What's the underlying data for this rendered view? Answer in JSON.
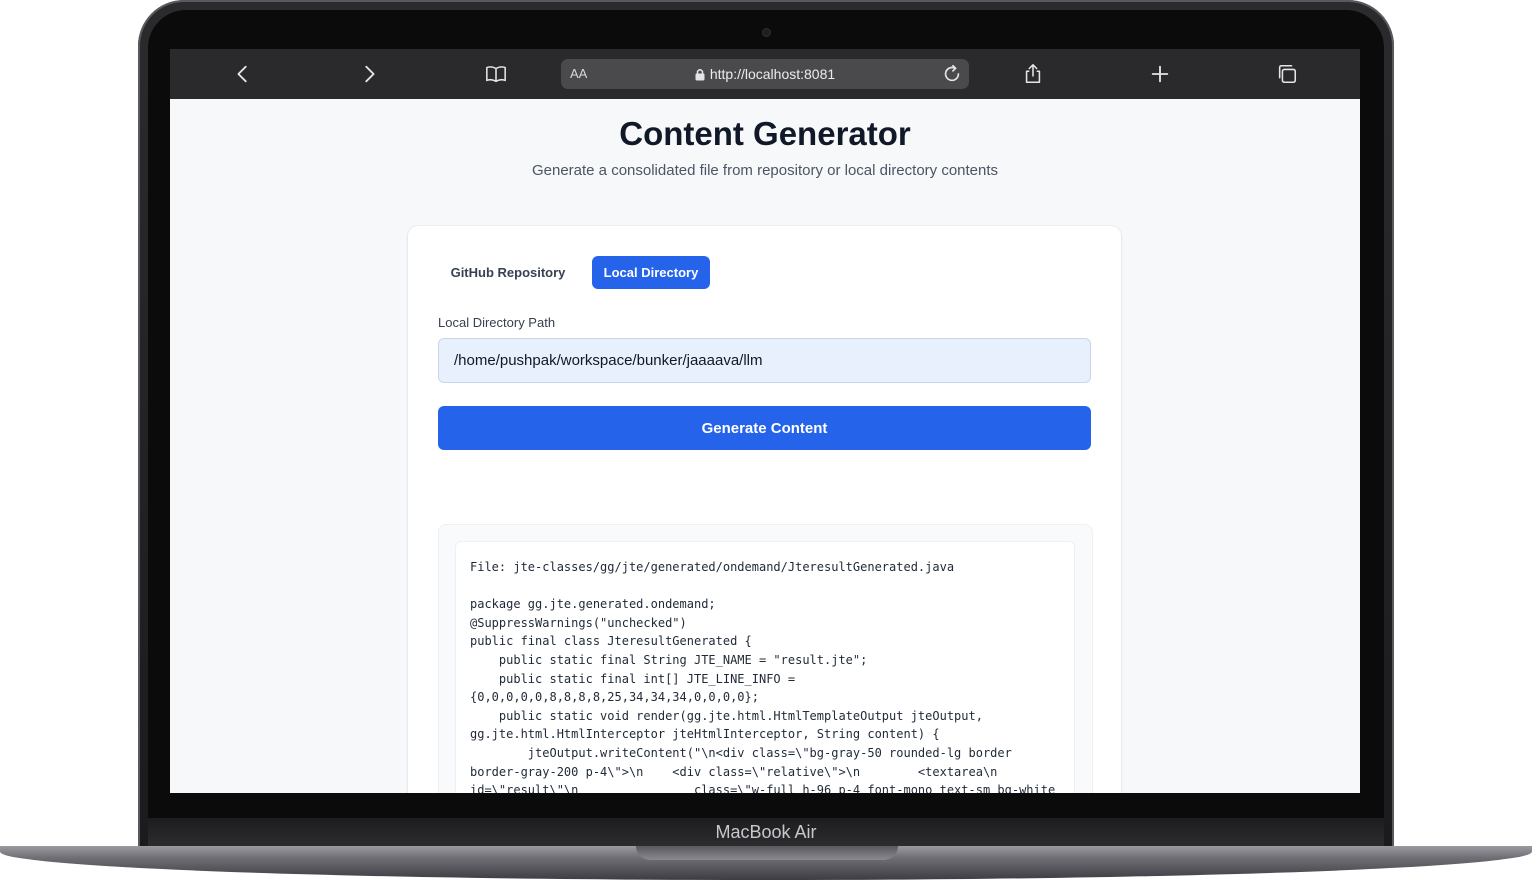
{
  "browser": {
    "url_size_label": "AA",
    "url": "http://localhost:8081"
  },
  "page": {
    "title": "Content Generator",
    "subtitle": "Generate a consolidated file from repository or local directory contents"
  },
  "tabs": [
    {
      "label": "GitHub Repository",
      "active": false
    },
    {
      "label": "Local Directory",
      "active": true
    }
  ],
  "form": {
    "path_label": "Local Directory Path",
    "path_value": "/home/pushpak/workspace/bunker/jaaaava/llm",
    "generate_label": "Generate Content"
  },
  "result": {
    "text": "File: jte-classes/gg/jte/generated/ondemand/JteresultGenerated.java\n\npackage gg.jte.generated.ondemand;\n@SuppressWarnings(\"unchecked\")\npublic final class JteresultGenerated {\n    public static final String JTE_NAME = \"result.jte\";\n    public static final int[] JTE_LINE_INFO =\n{0,0,0,0,0,8,8,8,8,25,34,34,34,0,0,0,0};\n    public static void render(gg.jte.html.HtmlTemplateOutput jteOutput,\ngg.jte.html.HtmlInterceptor jteHtmlInterceptor, String content) {\n        jteOutput.writeContent(\"\\n<div class=\\\"bg-gray-50 rounded-lg border\nborder-gray-200 p-4\\\">\\n    <div class=\\\"relative\\\">\\n        <textarea\\n\nid=\\\"result\\\"\\n                class=\\\"w-full h-96 p-4 font-mono text-sm bg-white"
  },
  "device": {
    "name": "MacBook Air"
  },
  "colors": {
    "accent": "#2563eb",
    "toolbar": "#2a2a2c",
    "page_bg": "#f6f8fa"
  }
}
